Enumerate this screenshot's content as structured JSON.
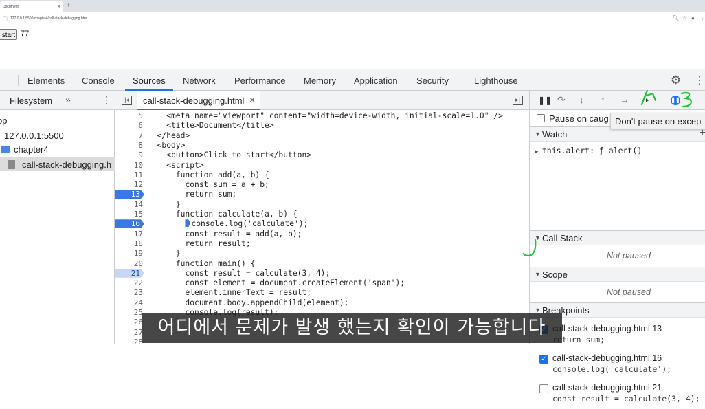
{
  "browser": {
    "tab_title": "Document",
    "tab_close": "×",
    "new_tab": "+",
    "url": "127.0.0.1:5500/chapter4/call-stack-debugging.html"
  },
  "page": {
    "button_label": "start",
    "result_text": "77"
  },
  "devtools": {
    "tabs": [
      "Elements",
      "Console",
      "Sources",
      "Network",
      "Performance",
      "Memory",
      "Application",
      "Security",
      "Lighthouse"
    ],
    "active_tab": "Sources",
    "navigator": {
      "title": "Filesystem",
      "more": "»",
      "items": [
        {
          "label": "op"
        },
        {
          "label": "127.0.0.1:5500"
        },
        {
          "label": "chapter4"
        },
        {
          "label": "call-stack-debugging.h"
        }
      ]
    },
    "editor": {
      "tab_name": "call-stack-debugging.html",
      "tab_close": "×",
      "lines": [
        {
          "n": "5",
          "code": "    <meta name=\"viewport\" content=\"width=device-width, initial-scale=1.0\" />"
        },
        {
          "n": "6",
          "code": "    <title>Document</title>"
        },
        {
          "n": "7",
          "code": "  </head>"
        },
        {
          "n": "8",
          "code": "  <body>"
        },
        {
          "n": "9",
          "code": "    <button>Click to start</button>"
        },
        {
          "n": "10",
          "code": "    <script>"
        },
        {
          "n": "11",
          "code": "      function add(a, b) {"
        },
        {
          "n": "12",
          "code": "        const sum = a + b;"
        },
        {
          "n": "13",
          "code": "        return sum;",
          "bp": "active"
        },
        {
          "n": "14",
          "code": "      }"
        },
        {
          "n": "15",
          "code": "      function calculate(a, b) {"
        },
        {
          "n": "16",
          "code": "console.log('calculate');",
          "bp": "active"
        },
        {
          "n": "17",
          "code": "        const result = add(a, b);"
        },
        {
          "n": "18",
          "code": "        return result;"
        },
        {
          "n": "19",
          "code": "      }"
        },
        {
          "n": "20",
          "code": "      function main() {"
        },
        {
          "n": "21",
          "code": "        const result = calculate(3, 4);",
          "bp": "light"
        },
        {
          "n": "22",
          "code": "        const element = document.createElement('span');"
        },
        {
          "n": "23",
          "code": "        element.innerText = result;"
        },
        {
          "n": "24",
          "code": "        document.body.appendChild(element);"
        },
        {
          "n": "25",
          "code": "        console.log(result);"
        },
        {
          "n": "26",
          "code": "      }"
        },
        {
          "n": "27",
          "code": ""
        },
        {
          "n": "28",
          "code": ""
        }
      ]
    },
    "debugger": {
      "pause_on_caught": "Pause on caug",
      "tooltip": "Don't pause on excep",
      "sections": {
        "watch": "Watch",
        "call_stack": "Call Stack",
        "scope": "Scope",
        "breakpoints": "Breakpoints"
      },
      "watch_plus": "+",
      "watch_item": "this.alert: ƒ alert()",
      "not_paused": "Not paused",
      "breakpoints": [
        {
          "file": "call-stack-debugging.html:13",
          "code": "return sum;",
          "checked": true
        },
        {
          "file": "call-stack-debugging.html:16",
          "code": "console.log('calculate');",
          "checked": true
        },
        {
          "file": "call-stack-debugging.html:21",
          "code": "const result = calculate(3, 4);",
          "checked": false
        }
      ]
    }
  },
  "subtitle": "어디에서 문제가 발생 했는지 확인이 가능합니다",
  "colors": {
    "accent": "#1a73e8",
    "breakpoint": "#3b78e7",
    "annotation": "#22c33a"
  }
}
